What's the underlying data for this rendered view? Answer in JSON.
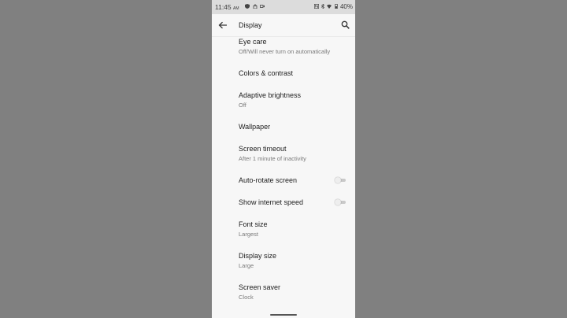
{
  "statusbar": {
    "time": "11:45",
    "ampm": "AM",
    "battery": "40%"
  },
  "appbar": {
    "title": "Display",
    "back_icon": "arrow-back-icon",
    "search_icon": "search-icon"
  },
  "settings": {
    "eye_care": {
      "label": "Eye care",
      "sub": "Off/Will never turn on automatically"
    },
    "colors": {
      "label": "Colors & contrast"
    },
    "adaptive": {
      "label": "Adaptive brightness",
      "sub": "Off"
    },
    "wallpaper": {
      "label": "Wallpaper"
    },
    "timeout": {
      "label": "Screen timeout",
      "sub": "After 1 minute of inactivity"
    },
    "autorotate": {
      "label": "Auto-rotate screen",
      "state": "off"
    },
    "internet_speed": {
      "label": "Show internet speed",
      "state": "off"
    },
    "font_size": {
      "label": "Font size",
      "sub": "Largest"
    },
    "display_size": {
      "label": "Display size",
      "sub": "Large"
    },
    "screen_saver": {
      "label": "Screen saver",
      "sub": "Clock"
    }
  },
  "colors": {
    "background": "#808080",
    "surface": "#f7f7f7",
    "statusbar": "#dcdcdc"
  }
}
